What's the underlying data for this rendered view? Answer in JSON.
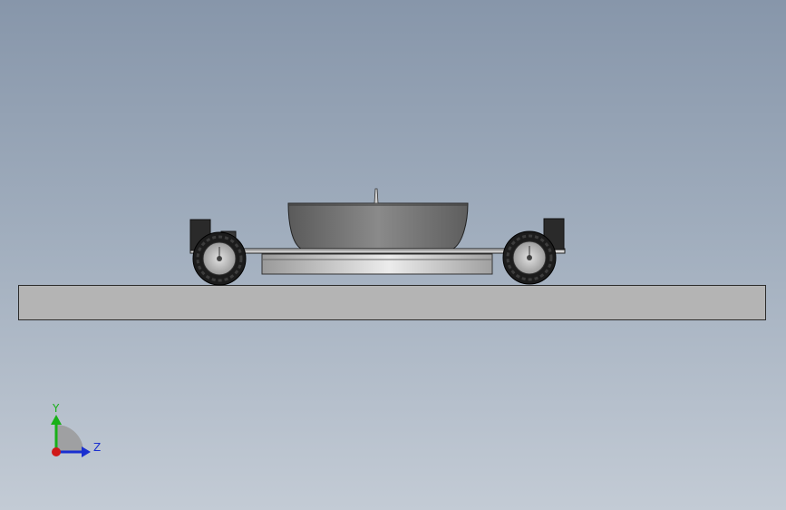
{
  "viewport": {
    "background_top": "#8796aa",
    "background_bottom": "#c3cbd5"
  },
  "ground": {
    "fill": "#b4b4b4",
    "edge": "#2c2c2c"
  },
  "model": {
    "body_color": "#7a7a7a",
    "tire_color": "#1c1c1c",
    "hub_color": "#c8c8c8",
    "platform_color": "#cfcfcf"
  },
  "triad": {
    "y_label": "Y",
    "z_label": "Z",
    "y_color": "#18b018",
    "z_color": "#1a2fd0",
    "x_color": "#d01818",
    "y_icon": "y-axis-arrow-icon",
    "z_icon": "z-axis-arrow-icon",
    "origin_icon": "x-axis-origin-icon"
  }
}
